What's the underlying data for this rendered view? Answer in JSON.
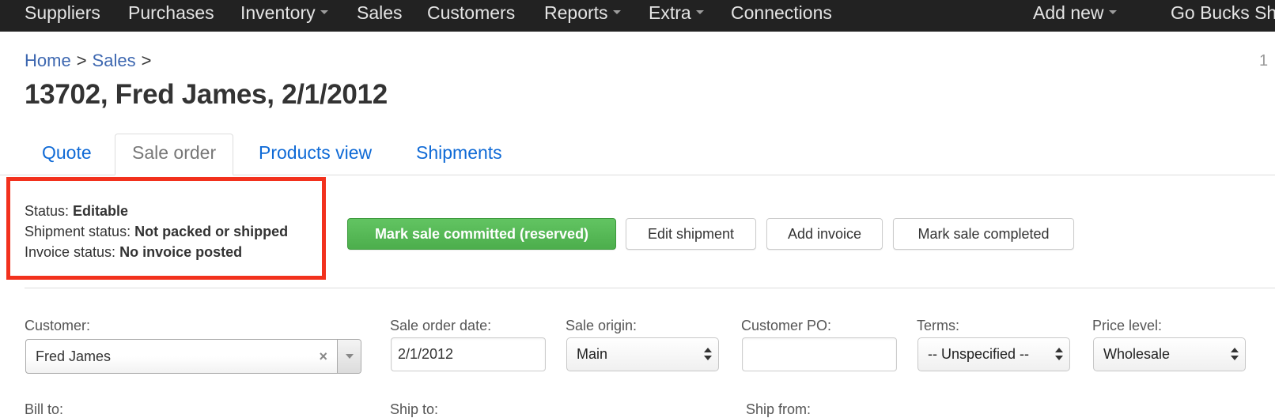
{
  "navbar": {
    "items": [
      {
        "label": "Suppliers",
        "dropdown": false
      },
      {
        "label": "Purchases",
        "dropdown": false
      },
      {
        "label": "Inventory",
        "dropdown": true
      },
      {
        "label": "Sales",
        "dropdown": false
      },
      {
        "label": "Customers",
        "dropdown": false
      },
      {
        "label": "Reports",
        "dropdown": true
      },
      {
        "label": "Extra",
        "dropdown": true
      },
      {
        "label": "Connections",
        "dropdown": false
      }
    ],
    "add_new": "Add new",
    "account": "Go Bucks Sh"
  },
  "breadcrumb": {
    "home": "Home",
    "sales": "Sales",
    "separator": ">"
  },
  "page_number": "1",
  "page_title": "13702, Fred James, 2/1/2012",
  "tabs": [
    {
      "label": "Quote",
      "active": false
    },
    {
      "label": "Sale order",
      "active": true
    },
    {
      "label": "Products view",
      "active": false
    },
    {
      "label": "Shipments",
      "active": false
    }
  ],
  "status": {
    "status_label": "Status:",
    "status_value": "Editable",
    "shipment_label": "Shipment status:",
    "shipment_value": "Not packed or shipped",
    "invoice_label": "Invoice status:",
    "invoice_value": "No invoice posted"
  },
  "actions": {
    "commit": "Mark sale committed (reserved)",
    "edit_shipment": "Edit shipment",
    "add_invoice": "Add invoice",
    "mark_completed": "Mark sale completed"
  },
  "form": {
    "customer_label": "Customer:",
    "customer_value": "Fred James",
    "clear_glyph": "×",
    "sale_order_date_label": "Sale order date:",
    "sale_order_date_value": "2/1/2012",
    "sale_origin_label": "Sale origin:",
    "sale_origin_value": "Main",
    "customer_po_label": "Customer PO:",
    "customer_po_value": "",
    "terms_label": "Terms:",
    "terms_value": "-- Unspecified --",
    "price_level_label": "Price level:",
    "price_level_value": "Wholesale",
    "bill_to_label": "Bill to:",
    "ship_to_label": "Ship to:",
    "ship_from_label": "Ship from:"
  },
  "colors": {
    "navbar_bg": "#222222",
    "link": "#3d67b0",
    "tab_link": "#0f6ad6",
    "highlight_border": "#f2311d",
    "success_button": "#5cb85c"
  }
}
